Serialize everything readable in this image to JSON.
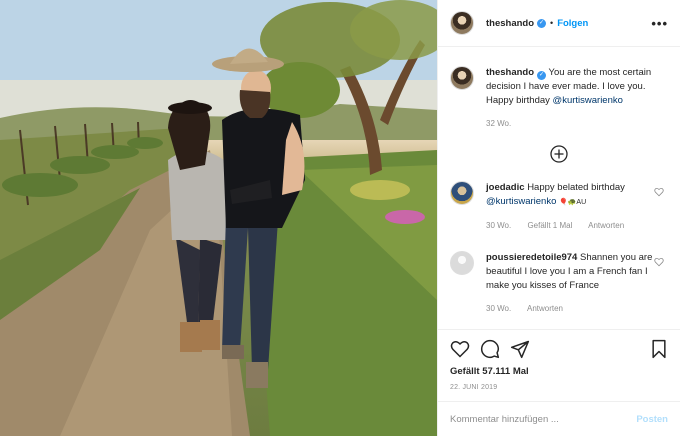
{
  "header": {
    "username": "theshando",
    "separator": "•",
    "follow_label": "Folgen",
    "more_label": "•••"
  },
  "caption": {
    "username": "theshando",
    "text": "You are the most certain decision I have ever made. I love you. Happy birthday ",
    "mention": "@kurtiswarienko",
    "time": "32 Wo."
  },
  "comments": [
    {
      "username": "joedadic",
      "text": "Happy belated birthday ",
      "mention": "@kurtiswarienko",
      "emoji_suffix": "🎈🐢AU",
      "time": "30 Wo.",
      "likes": "Gefällt 1 Mal",
      "reply_label": "Antworten"
    },
    {
      "username": "poussieredetoile974",
      "text": "Shannen you are beautiful I love you I am a French fan I make you kisses of France",
      "time": "30 Wo.",
      "reply_label": "Antworten"
    }
  ],
  "actions": {
    "likes_count": "Gefällt 57.111 Mal",
    "date": "22. JUNI 2019"
  },
  "add_comment": {
    "placeholder": "Kommentar hinzufügen ...",
    "post_label": "Posten"
  },
  "colors": {
    "accent_blue": "#0095f6",
    "verified_blue": "#3897f0",
    "muted_gray": "#8e8e8e",
    "post_disabled": "#b2dffc"
  },
  "icons": [
    "verified-badge-icon",
    "more-options-icon",
    "heart-icon",
    "comment-icon",
    "share-icon",
    "bookmark-icon",
    "load-more-plus-icon"
  ]
}
